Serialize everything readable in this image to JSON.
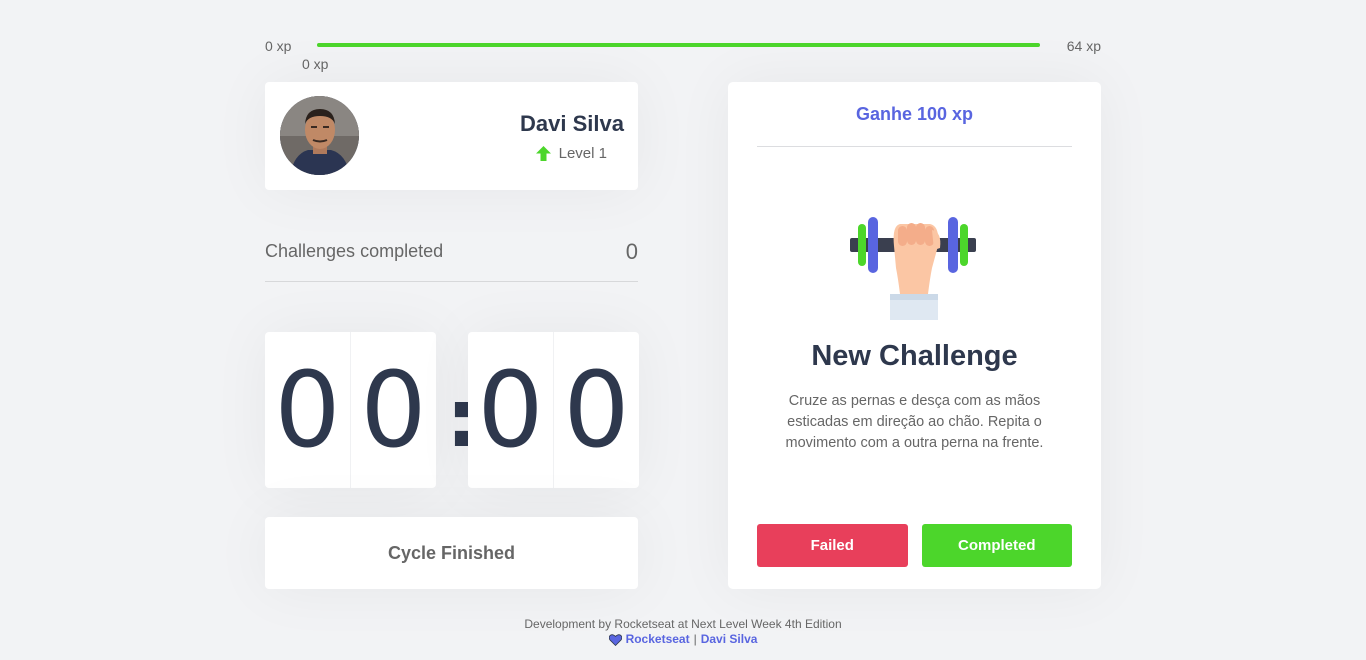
{
  "xp": {
    "min_label": "0 xp",
    "max_label": "64 xp",
    "current_label": "0 xp",
    "progress_fraction": 1.0
  },
  "profile": {
    "name": "Davi Silva",
    "level": "Level 1"
  },
  "completed_challenges": {
    "label": "Challenges completed",
    "value": "0"
  },
  "countdown": {
    "minute_left": "0",
    "minute_right": "0",
    "separator": ":",
    "second_left": "0",
    "second_right": "0"
  },
  "cycle_button": {
    "label": "Cycle Finished"
  },
  "challenge": {
    "reward": "Ganhe 100 xp",
    "icon": "dumbbell-hand-icon",
    "title": "New Challenge",
    "description": "Cruze as pernas e desça com as mãos esticadas em direção ao chão. Repita o movimento com a outra perna na frente.",
    "failed_label": "Failed",
    "completed_label": "Completed"
  },
  "footer": {
    "credit": "Development by Rocketseat at Next Level Week 4th Edition",
    "link_rocketseat": "Rocketseat",
    "separator": "|",
    "link_author": "Davi Silva"
  },
  "colors": {
    "green": "#4cd62b",
    "red": "#e83f5b",
    "blue": "#5965e0",
    "title": "#2e384d",
    "text": "#666666",
    "background": "#f2f3f5"
  }
}
